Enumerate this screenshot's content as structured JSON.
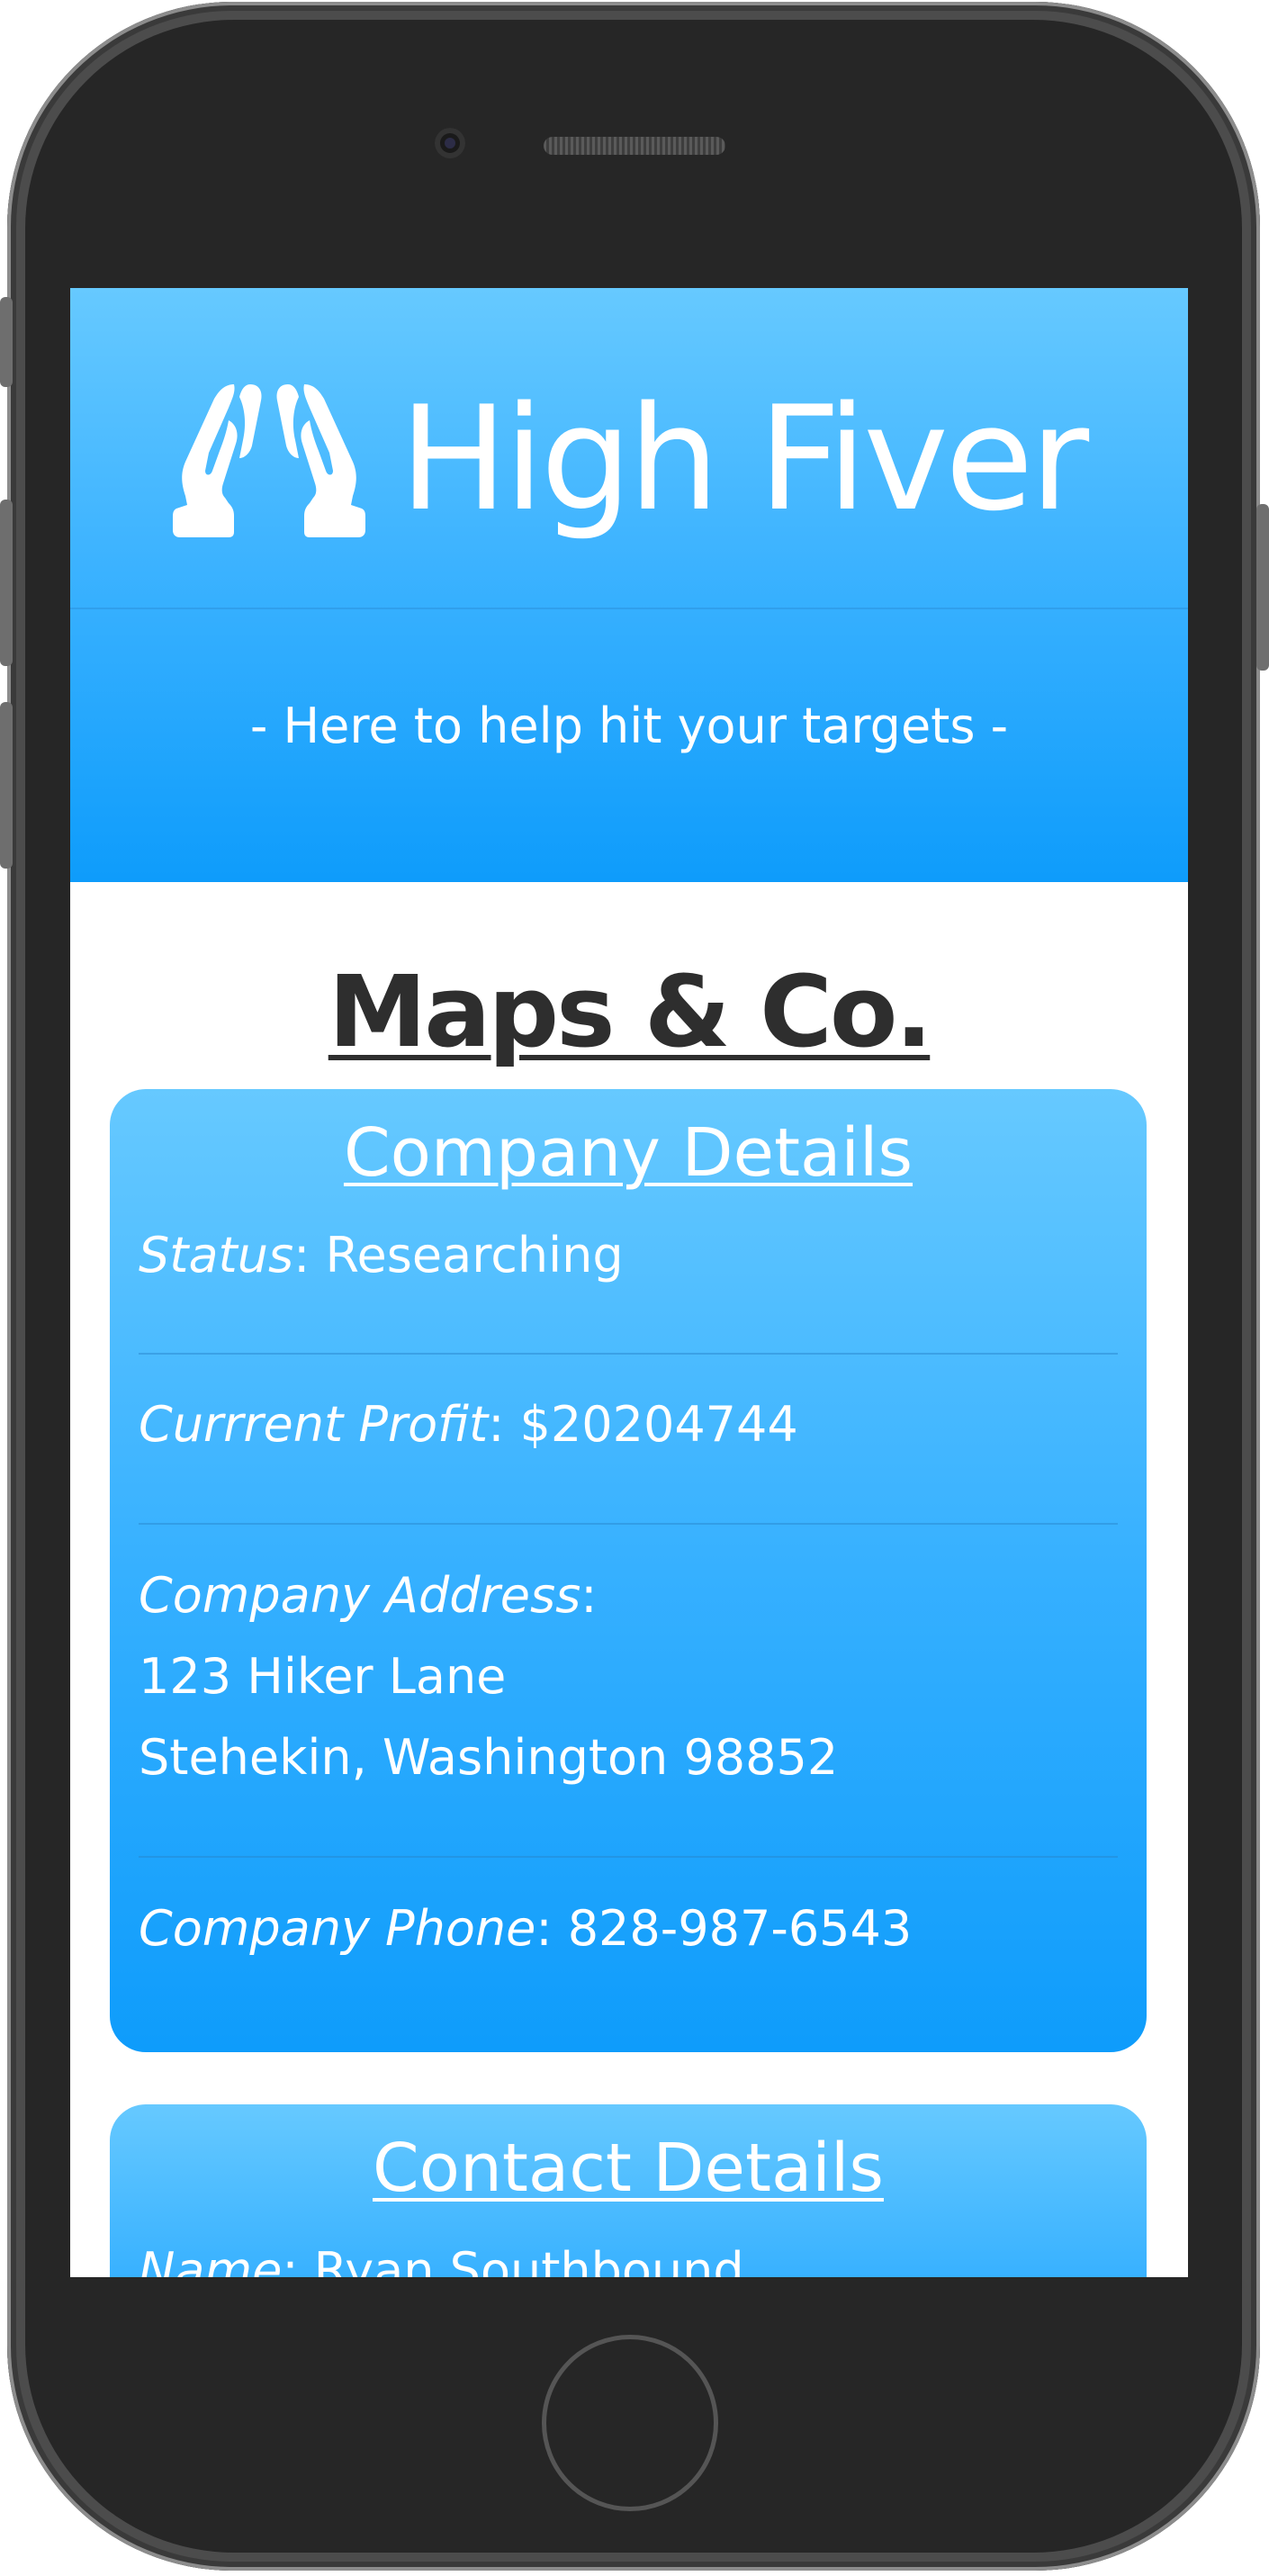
{
  "app": {
    "title": "High Fiver",
    "tagline": "- Here to help hit your targets -",
    "logo_icon": "high-five-hands-icon"
  },
  "company": {
    "name": "Maps & Co."
  },
  "company_details": {
    "heading": "Company Details",
    "status_label": "Status",
    "status_value": "Researching",
    "profit_label": "Currrent Profit",
    "profit_value": "$20204744",
    "address_label": "Company Address",
    "address_line1": "123 Hiker Lane",
    "address_line2": "Stehekin, Washington 98852",
    "phone_label": "Company Phone",
    "phone_value": "828-987-6543"
  },
  "contact_details": {
    "heading": "Contact Details",
    "name_label": "Name",
    "name_value": "Ryan Southbound"
  },
  "colors": {
    "header_top": "#66c9ff",
    "header_bottom": "#0e9cfb",
    "card_top": "#66c9ff",
    "card_bottom": "#0e9cfb",
    "title_text": "#2e2e2e",
    "device_frame": "#262626"
  }
}
